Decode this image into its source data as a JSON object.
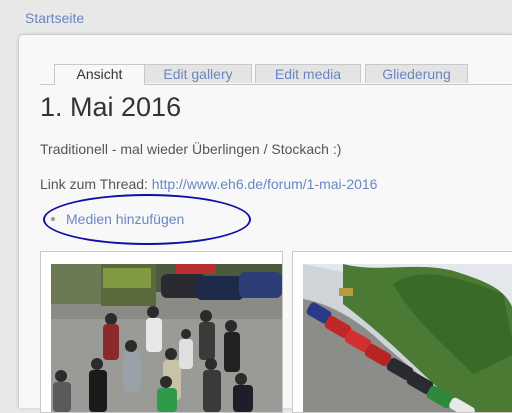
{
  "breadcrumb": {
    "label": "Startseite"
  },
  "tabs": [
    {
      "label": "Ansicht",
      "active": true
    },
    {
      "label": "Edit gallery",
      "active": false
    },
    {
      "label": "Edit media",
      "active": false
    },
    {
      "label": "Gliederung",
      "active": false
    }
  ],
  "page": {
    "title": "1. Mai 2016",
    "description": "Traditionell - mal wieder Überlingen / Stockach :)",
    "link_prefix": "Link zum Thread: ",
    "link_url": "http://www.eh6.de/forum/1-mai-2016"
  },
  "media": {
    "add_label": "Medien hinzufügen"
  },
  "colors": {
    "link": "#6a86c4",
    "highlight_oval": "#1010a6",
    "text": "#333333"
  }
}
